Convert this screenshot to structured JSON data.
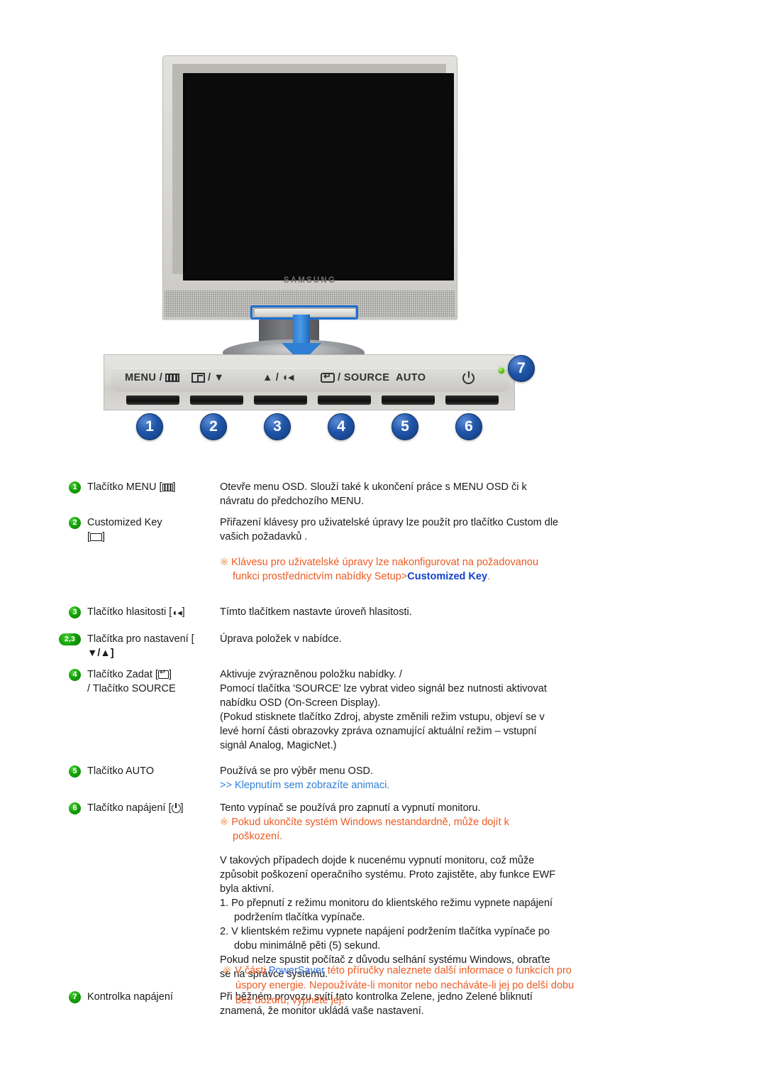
{
  "figure": {
    "brand": "SAMSUNG",
    "highlight_label": "control-panel-highlight",
    "callouts": [
      "1",
      "2",
      "3",
      "4",
      "5",
      "6",
      "7"
    ],
    "panel_labels": [
      {
        "id": "menu",
        "prefix": "MENU /",
        "icon": "menu-grid-icon"
      },
      {
        "id": "custom",
        "prefix": "",
        "icon": "customized-key-icon",
        "suffix": "/ ▼"
      },
      {
        "id": "volume",
        "prefix": "▲ /",
        "icon": "volume-icon"
      },
      {
        "id": "source",
        "prefix": "",
        "icon": "enter-icon",
        "suffix": "/ SOURCE"
      },
      {
        "id": "auto",
        "prefix": "AUTO",
        "icon": ""
      },
      {
        "id": "power",
        "prefix": "",
        "icon": "power-icon"
      }
    ],
    "auto_label": "AUTO",
    "menu_label": "MENU /",
    "source_label": "/ SOURCE",
    "down_triangle": "▼",
    "up_triangle": "▲",
    "slash": "/"
  },
  "colors": {
    "callout_blue": "#1f55a8",
    "bullet_green": "#16a509",
    "note_orange": "#ec5a22",
    "link_blue": "#2f7fd4",
    "highlight_blue": "#1142cf"
  },
  "rows": [
    {
      "bullet": "1",
      "bullet_type": "circle",
      "name_prefix": "Tlačítko MENU [",
      "name_icon": "menu-grid-icon",
      "name_suffix": "]",
      "desc": "Otevře menu OSD. Slouží také k ukončení práce s MENU OSD či k návratu do předchozího MENU."
    },
    {
      "bullet": "2",
      "bullet_type": "circle",
      "name_prefix": "Customized Key",
      "name_icon": "customized-key-icon",
      "name_line2_open": "[",
      "name_line2_close": "]",
      "desc": "Přiřazení klávesy pro uživatelské úpravy lze použít pro tlačítko Custom dle vašich požadavků .",
      "note_mark": "※",
      "note_a": "Klávesu pro uživatelské úpravy lze nakonfigurovat na požadovanou funkci prostřednictvím nabídky Setup>",
      "note_hl": "Customized Key",
      "note_b": "."
    },
    {
      "bullet": "3",
      "bullet_type": "circle",
      "name_prefix": "Tlačítko hlasitosti [",
      "name_icon": "volume-icon",
      "name_suffix": "]",
      "desc": "Tímto tlačítkem nastavte úroveň hlasitosti."
    },
    {
      "bullet": "2,3",
      "bullet_type": "pill",
      "name_line1": "Tlačítka pro nastavení [",
      "name_line2": "▼/▲]",
      "desc": "Úprava položek v nabídce."
    },
    {
      "bullet": "4",
      "bullet_type": "circle",
      "name_prefix": "Tlačítko Zadat [",
      "name_icon": "enter-icon",
      "name_suffix": "]",
      "name_line2": "/ Tlačítko SOURCE",
      "desc_lines": [
        "Aktivuje zvýrazněnou položku nabídky. /",
        "Pomocí tlačítka 'SOURCE' lze vybrat video signál bez nutnosti aktivovat nabídku OSD (On-Screen Display).",
        "(Pokud stisknete tlačítko Zdroj, abyste změnili režim vstupu, objeví se v levé horní části obrazovky zpráva oznamující aktuální režim – vstupní signál Analog, MagicNet.)"
      ]
    },
    {
      "bullet": "5",
      "bullet_type": "circle",
      "name_line1": "Tlačítko AUTO",
      "desc": "Používá se pro výběr menu OSD.",
      "link": ">> Klepnutím sem zobrazíte animaci."
    },
    {
      "bullet": "6",
      "bullet_type": "circle",
      "name_prefix": "Tlačítko napájení [",
      "name_icon": "power-icon",
      "name_suffix": "]",
      "desc": "Tento vypínač se používá pro zapnutí a vypnutí monitoru.",
      "note_mark": "※",
      "note": "Pokud ukončíte systém Windows nestandardně, může dojít k poškození.",
      "body": "V takových případech dojde k nucenému vypnutí monitoru, což může způsobit poškození operačního systému. Proto zajistěte, aby funkce EWF byla aktivní.",
      "steps": [
        "1.  Po přepnutí z režimu monitoru do klientského režimu vypnete napájení podržením tlačítka vypínače.",
        "2.  V klientském režimu vypnete napájení podržením tlačítka vypínače po dobu minimálně pěti (5) sekund."
      ],
      "tail": "Pokud nelze spustit počítač z důvodu selhání systému Windows, obraťte se na správce systému."
    },
    {
      "bullet": "7",
      "bullet_type": "circle",
      "name_line1": "Kontrolka napájení",
      "desc": "Při běžném provozu svítí tato kontrolka Zelene, jedno Zelené bliknutí znamená, že monitor ukládá vaše nastavení."
    }
  ],
  "footer": {
    "mark": "※",
    "part_a": "V části ",
    "hl": "PowerSaver",
    "part_b": " této příručky naleznete další informace o funkcích pro úspory energie. Nepoužíváte-li monitor nebo necháváte-li jej po delší dobu bez dozoru, vypněte jej."
  }
}
